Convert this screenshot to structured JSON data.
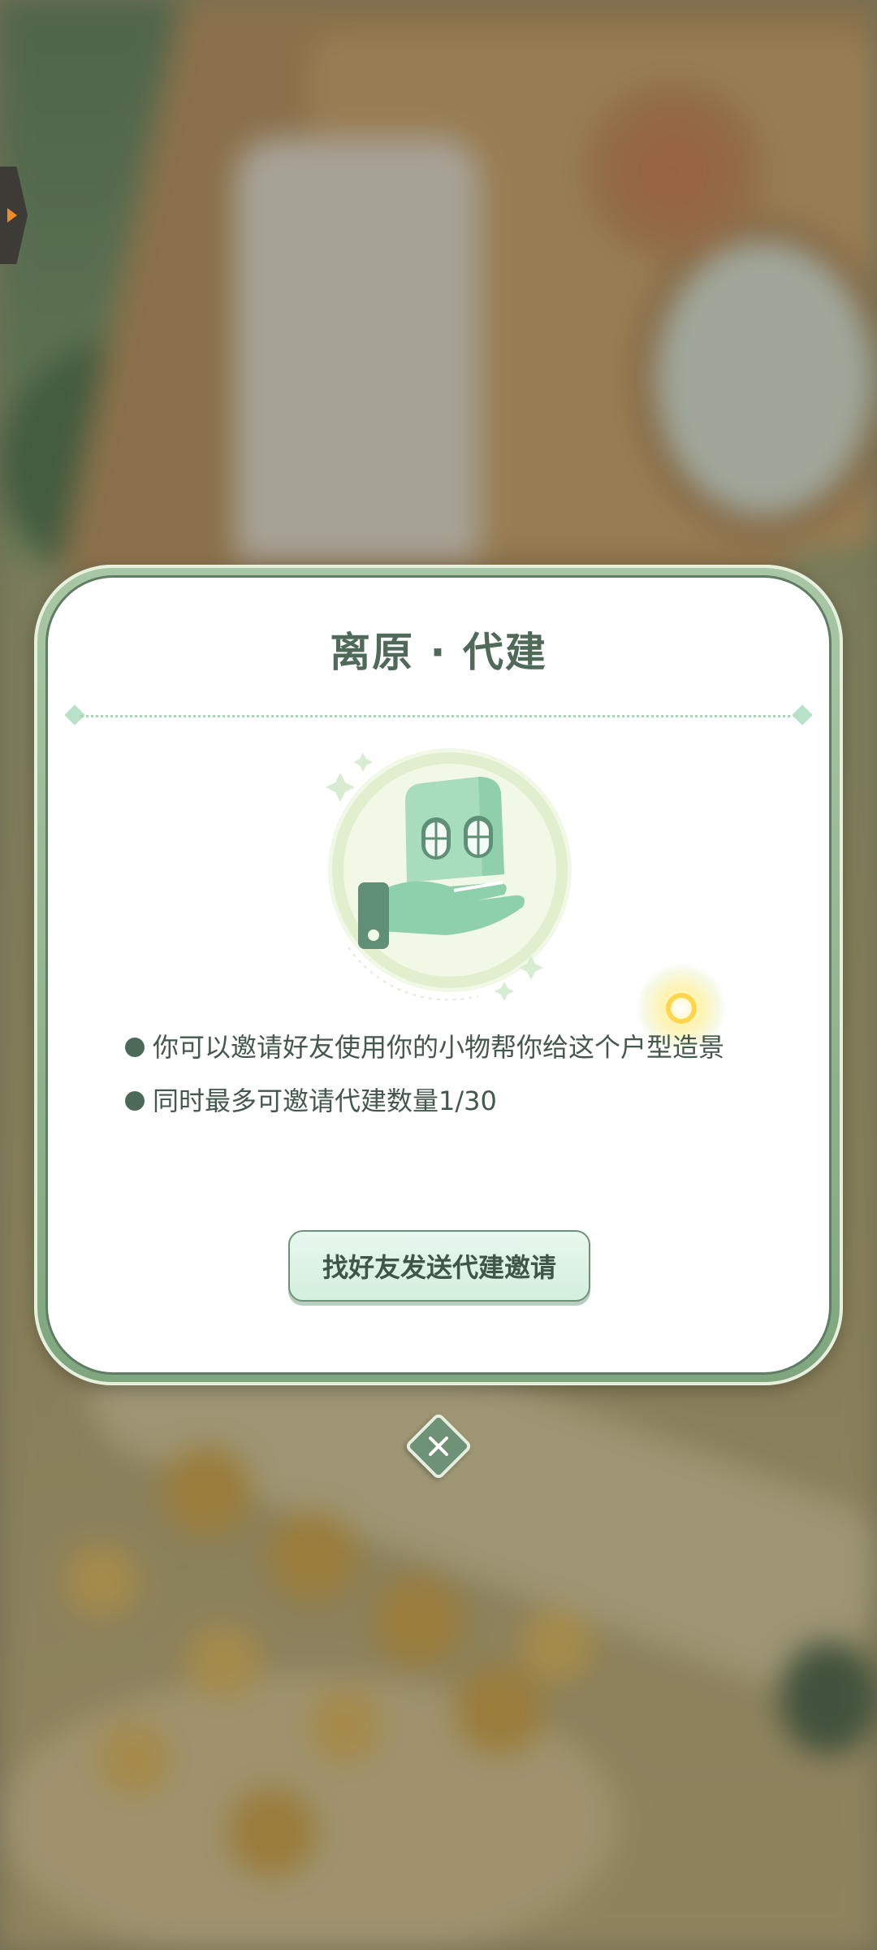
{
  "dialog": {
    "title": "离原 · 代建",
    "info_items": [
      "你可以邀请好友使用你的小物帮你给这个户型造景",
      "同时最多可邀请代建数量1/30"
    ],
    "invite_button_label": "找好友发送代建邀请"
  },
  "icons": {
    "side_tab": "expand-arrow-icon",
    "illustration": "hand-holding-house-icon",
    "decoration": "sun-sparkle-icon",
    "close": "close-icon"
  },
  "colors": {
    "title": "#4f6a59",
    "accent_green": "#6d9275",
    "button_fill": "#d3efdd",
    "side_tab_arrow": "#f08a2a"
  }
}
